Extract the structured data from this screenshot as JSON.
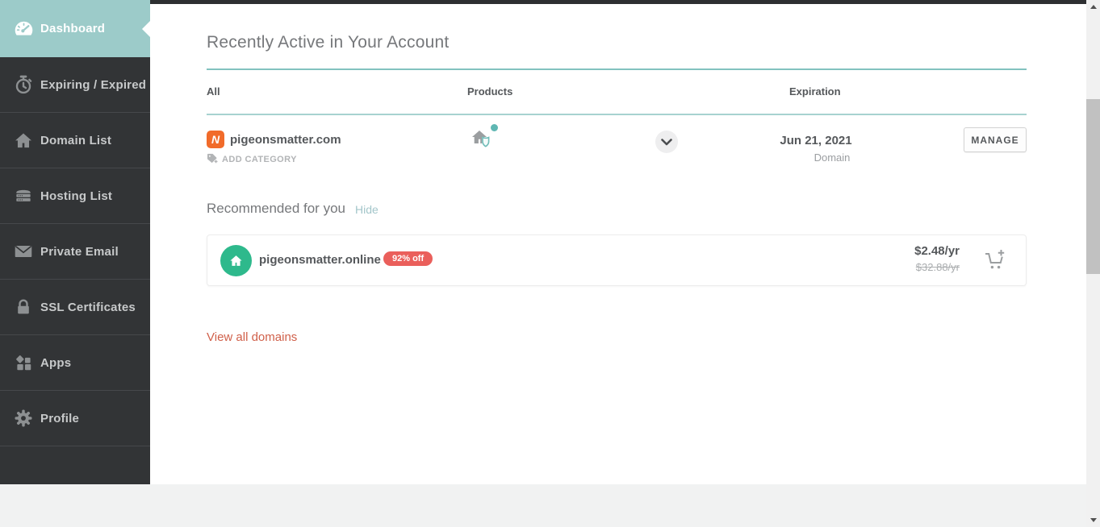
{
  "sidebar": {
    "items": [
      {
        "label": "Dashboard",
        "icon": "dashboard-gauge-icon",
        "active": true
      },
      {
        "label": "Expiring / Expired",
        "icon": "stopwatch-icon",
        "active": false
      },
      {
        "label": "Domain List",
        "icon": "home-icon",
        "active": false
      },
      {
        "label": "Hosting List",
        "icon": "server-icon",
        "active": false
      },
      {
        "label": "Private Email",
        "icon": "envelope-icon",
        "active": false
      },
      {
        "label": "SSL Certificates",
        "icon": "lock-icon",
        "active": false
      },
      {
        "label": "Apps",
        "icon": "apps-grid-icon",
        "active": false
      },
      {
        "label": "Profile",
        "icon": "gear-icon",
        "active": false
      }
    ]
  },
  "main": {
    "section_title": "Recently Active in Your Account",
    "table": {
      "columns": [
        "All",
        "Products",
        "Expiration"
      ],
      "row": {
        "domain": "pigeonsmatter.com",
        "add_category_label": "ADD CATEGORY",
        "products_icon": "domain-with-shield-icon",
        "expiration_date": "Jun 21, 2021",
        "product_type": "Domain",
        "manage_label": "MANAGE"
      }
    },
    "recommended": {
      "title": "Recommended for you",
      "hide_label": "Hide",
      "item": {
        "domain": "pigeonsmatter.online",
        "discount_badge": "92% off",
        "price": "$2.48/yr",
        "old_price": "$32.88/yr"
      }
    },
    "view_all_label": "View all domains"
  },
  "brand": {
    "logo_letter": "N",
    "colors": {
      "accent_teal": "#9ccbc9",
      "sidebar_bg": "#323436",
      "brand_orange": "#f16b2a",
      "brand_green": "#2eb98c",
      "badge_red": "#ea5f5b",
      "link_red": "#d0604a",
      "link_teal": "#a3c6ca"
    }
  }
}
